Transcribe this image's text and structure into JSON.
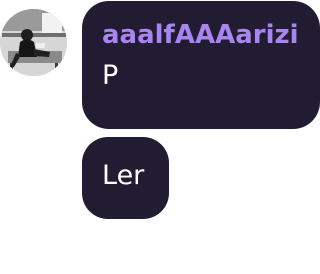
{
  "messages": [
    {
      "sender": "aaalfAAAarizi",
      "text": "P",
      "has_avatar": true
    },
    {
      "text": "Ler"
    }
  ],
  "colors": {
    "bubble_background": "#221c33",
    "sender_name": "#a885f0",
    "message_text": "#ffffff",
    "page_background": "#ffffff"
  },
  "icons": {
    "avatar": "user-photo-avatar"
  }
}
